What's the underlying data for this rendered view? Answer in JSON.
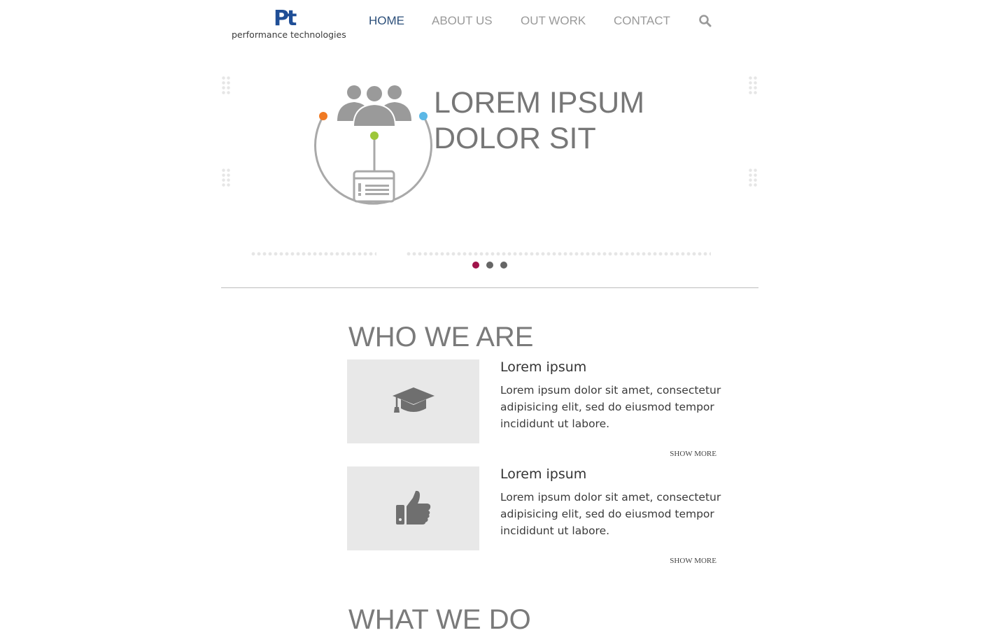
{
  "brand": {
    "logo_mark": "Pt",
    "logo_text": "performance technologies",
    "colors": {
      "primary": "#1f4e96",
      "accent": "#a0144a",
      "text_gray": "#777777"
    }
  },
  "nav": {
    "items": [
      {
        "label": "HOME",
        "active": true
      },
      {
        "label": "ABOUT US",
        "active": false
      },
      {
        "label": "OUT WORK",
        "active": false
      },
      {
        "label": "CONTACT",
        "active": false
      }
    ],
    "search_icon": "search-icon"
  },
  "hero": {
    "title_line1": "LOREM IPSUM",
    "title_line2": "DOLOR SIT",
    "illustration": "team-network-icon",
    "carousel": {
      "slides": 3,
      "active_index": 0
    }
  },
  "who_we_are": {
    "title": "WHO WE ARE",
    "cards": [
      {
        "icon": "graduation-cap-icon",
        "heading": "Lorem ipsum",
        "body": "Lorem ipsum dolor sit amet, consectetur adipisicing elit, sed do eiusmod tempor incididunt ut labore.",
        "link": "SHOW MORE"
      },
      {
        "icon": "thumbs-up-icon",
        "heading": "Lorem ipsum",
        "body": "Lorem ipsum dolor sit amet, consectetur adipisicing elit, sed do eiusmod tempor incididunt ut labore.",
        "link": "SHOW MORE"
      }
    ]
  },
  "what_we_do": {
    "title": "WHAT WE DO"
  }
}
